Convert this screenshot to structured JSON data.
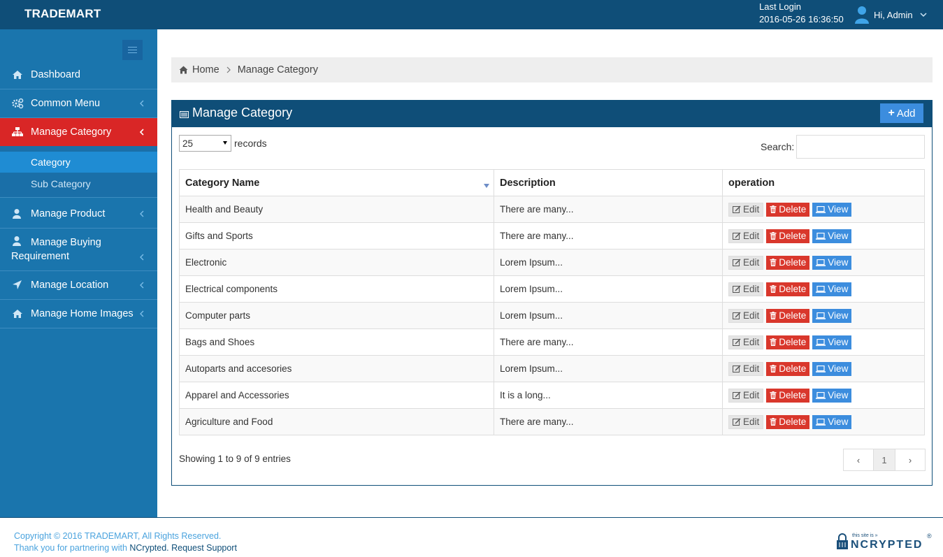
{
  "header": {
    "brand": "TRADEMART",
    "last_login_label": "Last Login",
    "last_login_time": "2016-05-26 16:36:50",
    "user_greeting": "Hi, Admin"
  },
  "sidebar": {
    "items": [
      {
        "label": "Dashboard",
        "icon": "home-icon"
      },
      {
        "label": "Common Menu",
        "icon": "gears-icon"
      },
      {
        "label": "Manage Category",
        "icon": "sitemap-icon"
      },
      {
        "label": "Manage Product",
        "icon": "user-icon"
      },
      {
        "label": "Manage Buying Requirement",
        "icon": "user-icon"
      },
      {
        "label": "Manage Location",
        "icon": "location-arrow-icon"
      },
      {
        "label": "Manage Home Images",
        "icon": "home-icon"
      }
    ],
    "submenu": [
      {
        "label": "Category"
      },
      {
        "label": "Sub Category"
      }
    ]
  },
  "breadcrumb": {
    "home": "Home",
    "current": "Manage Category"
  },
  "panel": {
    "title": "Manage Category",
    "add_label": "Add",
    "page_length": "25",
    "records_label": "records",
    "search_label": "Search:",
    "search_value": "",
    "columns": [
      "Category Name",
      "Description",
      "operation"
    ],
    "rows": [
      {
        "name": "Health and Beauty",
        "desc": "There are many..."
      },
      {
        "name": "Gifts and Sports",
        "desc": "There are many..."
      },
      {
        "name": "Electronic",
        "desc": "Lorem Ipsum..."
      },
      {
        "name": "Electrical components",
        "desc": "Lorem Ipsum..."
      },
      {
        "name": "Computer parts",
        "desc": "Lorem Ipsum..."
      },
      {
        "name": "Bags and Shoes",
        "desc": "There are many..."
      },
      {
        "name": "Autoparts and accesories",
        "desc": "Lorem Ipsum..."
      },
      {
        "name": "Apparel and Accessories",
        "desc": "It is a long..."
      },
      {
        "name": "Agriculture and Food",
        "desc": "There are many..."
      }
    ],
    "actions": {
      "edit": "Edit",
      "delete": "Delete",
      "view": "View"
    },
    "info": "Showing 1 to 9 of 9 entries",
    "pagination": {
      "prev": "‹",
      "current": "1",
      "next": "›"
    }
  },
  "footer": {
    "copyright": "Copyright © 2016 TRADEMART, All Rights Reserved.",
    "thanks_prefix": "Thank you for partnering with ",
    "partner": "NCrypted",
    "separator": ". ",
    "support": "Request Support",
    "logo_small": "this site is »",
    "logo_big": "NCRYPTED",
    "logo_reg": "®"
  },
  "colors": {
    "topbar": "#0f4e78",
    "sidebar": "#1a75ad",
    "active": "#d92626",
    "primary": "#3c8dde",
    "danger": "#d9372c"
  }
}
